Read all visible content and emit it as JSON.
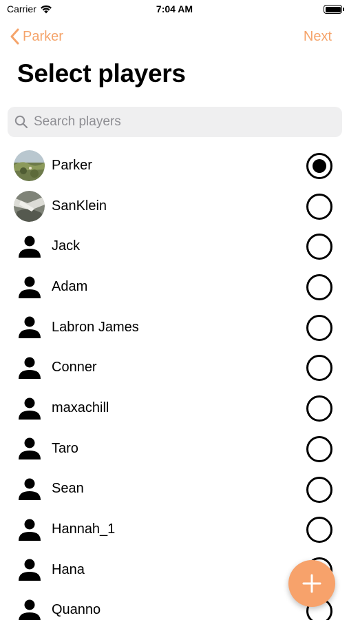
{
  "status_bar": {
    "carrier": "Carrier",
    "time": "7:04 AM"
  },
  "nav": {
    "back_label": "Parker",
    "next_label": "Next"
  },
  "title": "Select players",
  "search": {
    "placeholder": "Search players",
    "value": ""
  },
  "players": [
    {
      "name": "Parker",
      "avatar": "photo",
      "selected": true
    },
    {
      "name": "SanKlein",
      "avatar": "photo",
      "selected": false
    },
    {
      "name": "Jack",
      "avatar": "person-icon",
      "selected": false
    },
    {
      "name": "Adam",
      "avatar": "person-icon",
      "selected": false
    },
    {
      "name": "Labron James",
      "avatar": "person-icon",
      "selected": false
    },
    {
      "name": "Conner",
      "avatar": "person-icon",
      "selected": false
    },
    {
      "name": "maxachill",
      "avatar": "person-icon",
      "selected": false
    },
    {
      "name": "Taro",
      "avatar": "person-icon",
      "selected": false
    },
    {
      "name": "Sean",
      "avatar": "person-icon",
      "selected": false
    },
    {
      "name": "Hannah_1",
      "avatar": "person-icon",
      "selected": false
    },
    {
      "name": "Hana",
      "avatar": "person-icon",
      "selected": false
    },
    {
      "name": "Quanno",
      "avatar": "person-icon",
      "selected": false
    }
  ],
  "colors": {
    "accent": "#f5a46b",
    "fab": "#f7a26b",
    "search_bg": "#efeff0"
  },
  "fab": {
    "icon": "plus-icon"
  }
}
